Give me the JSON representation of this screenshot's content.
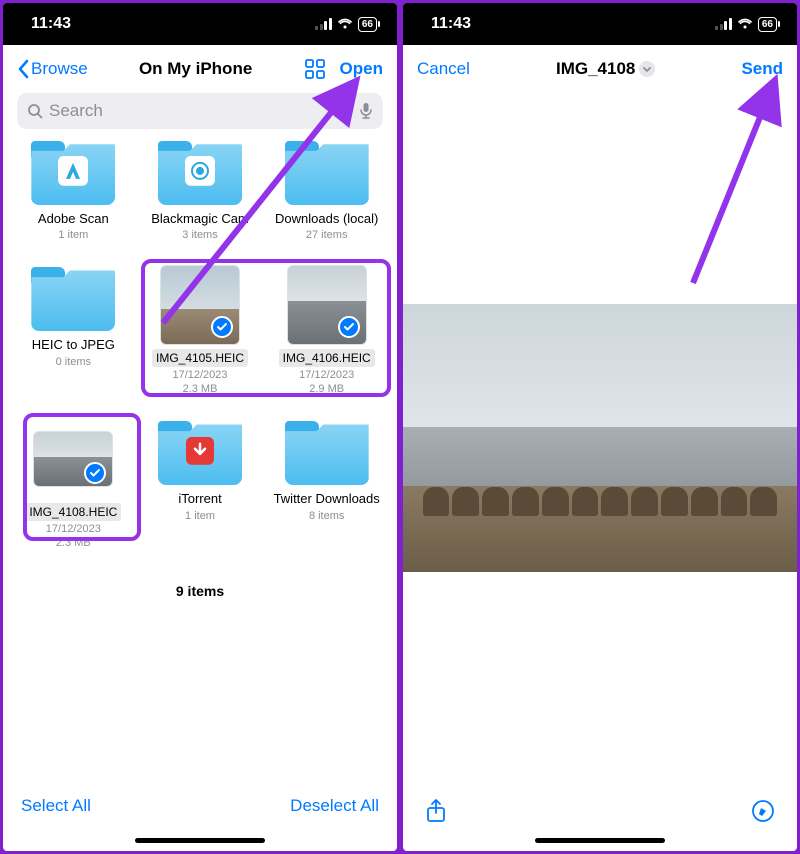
{
  "status": {
    "time": "11:43",
    "battery": "66"
  },
  "left": {
    "back": "Browse",
    "title": "On My iPhone",
    "open": "Open",
    "search_placeholder": "Search",
    "folders_row1": [
      {
        "name": "Adobe Scan",
        "meta": "1 item"
      },
      {
        "name": "Blackmagic Cam",
        "meta": "3 items"
      },
      {
        "name": "Downloads (local)",
        "meta": "27 items"
      }
    ],
    "row2": {
      "folder": {
        "name": "HEIC to JPEG",
        "meta": "0 items"
      },
      "img1": {
        "name": "IMG_4105.HEIC",
        "date": "17/12/2023",
        "size": "2.3 MB"
      },
      "img2": {
        "name": "IMG_4106.HEIC",
        "date": "17/12/2023",
        "size": "2.9 MB"
      }
    },
    "row3": {
      "img": {
        "name": "IMG_4108.HEIC",
        "date": "17/12/2023",
        "size": "2.3 MB"
      },
      "folder1": {
        "name": "iTorrent",
        "meta": "1 item"
      },
      "folder2": {
        "name": "Twitter Downloads",
        "meta": "8 items"
      }
    },
    "count": "9 items",
    "select_all": "Select All",
    "deselect_all": "Deselect All"
  },
  "right": {
    "cancel": "Cancel",
    "title": "IMG_4108",
    "send": "Send"
  }
}
